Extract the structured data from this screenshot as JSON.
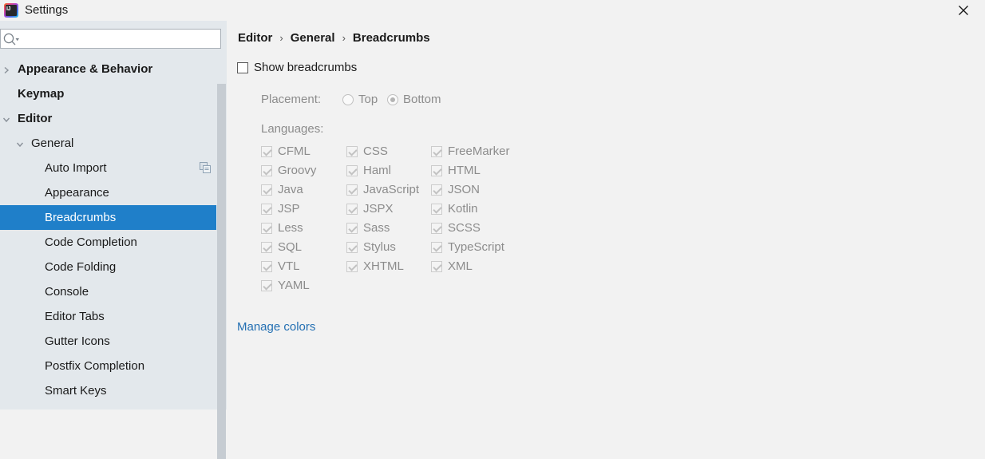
{
  "window": {
    "title": "Settings",
    "app_icon": "intellij-idea-logo",
    "close_icon": "close-icon"
  },
  "search": {
    "icon": "search-icon",
    "value": "",
    "placeholder": ""
  },
  "sidebar": {
    "items": [
      {
        "label": "Appearance & Behavior",
        "indent": 22,
        "bold": true,
        "arrow": "collapsed",
        "selected": false
      },
      {
        "label": "Keymap",
        "indent": 22,
        "bold": true,
        "arrow": "none",
        "selected": false
      },
      {
        "label": "Editor",
        "indent": 22,
        "bold": true,
        "arrow": "expanded",
        "selected": false
      },
      {
        "label": "General",
        "indent": 39,
        "bold": false,
        "arrow": "expanded",
        "selected": false
      },
      {
        "label": "Auto Import",
        "indent": 56,
        "bold": false,
        "arrow": "none",
        "selected": false,
        "action_icon": "copy-icon"
      },
      {
        "label": "Appearance",
        "indent": 56,
        "bold": false,
        "arrow": "none",
        "selected": false
      },
      {
        "label": "Breadcrumbs",
        "indent": 56,
        "bold": false,
        "arrow": "none",
        "selected": true
      },
      {
        "label": "Code Completion",
        "indent": 56,
        "bold": false,
        "arrow": "none",
        "selected": false
      },
      {
        "label": "Code Folding",
        "indent": 56,
        "bold": false,
        "arrow": "none",
        "selected": false
      },
      {
        "label": "Console",
        "indent": 56,
        "bold": false,
        "arrow": "none",
        "selected": false
      },
      {
        "label": "Editor Tabs",
        "indent": 56,
        "bold": false,
        "arrow": "none",
        "selected": false
      },
      {
        "label": "Gutter Icons",
        "indent": 56,
        "bold": false,
        "arrow": "none",
        "selected": false
      },
      {
        "label": "Postfix Completion",
        "indent": 56,
        "bold": false,
        "arrow": "none",
        "selected": false
      },
      {
        "label": "Smart Keys",
        "indent": 56,
        "bold": false,
        "arrow": "none",
        "selected": false
      }
    ]
  },
  "main": {
    "breadcrumb": {
      "items": [
        "Editor",
        "General",
        "Breadcrumbs"
      ],
      "separator": "›"
    },
    "show_breadcrumbs": {
      "label": "Show breadcrumbs",
      "checked": false
    },
    "placement": {
      "label": "Placement:",
      "options": [
        {
          "label": "Top",
          "selected": false
        },
        {
          "label": "Bottom",
          "selected": true
        }
      ]
    },
    "languages": {
      "label": "Languages:",
      "items": [
        {
          "label": "CFML",
          "checked": true,
          "col": 0,
          "row": 0
        },
        {
          "label": "CSS",
          "checked": true,
          "col": 1,
          "row": 0
        },
        {
          "label": "FreeMarker",
          "checked": true,
          "col": 2,
          "row": 0
        },
        {
          "label": "Groovy",
          "checked": true,
          "col": 0,
          "row": 1
        },
        {
          "label": "Haml",
          "checked": true,
          "col": 1,
          "row": 1
        },
        {
          "label": "HTML",
          "checked": true,
          "col": 2,
          "row": 1
        },
        {
          "label": "Java",
          "checked": true,
          "col": 0,
          "row": 2
        },
        {
          "label": "JavaScript",
          "checked": true,
          "col": 1,
          "row": 2
        },
        {
          "label": "JSON",
          "checked": true,
          "col": 2,
          "row": 2
        },
        {
          "label": "JSP",
          "checked": true,
          "col": 0,
          "row": 3
        },
        {
          "label": "JSPX",
          "checked": true,
          "col": 1,
          "row": 3
        },
        {
          "label": "Kotlin",
          "checked": true,
          "col": 2,
          "row": 3
        },
        {
          "label": "Less",
          "checked": true,
          "col": 0,
          "row": 4
        },
        {
          "label": "Sass",
          "checked": true,
          "col": 1,
          "row": 4
        },
        {
          "label": "SCSS",
          "checked": true,
          "col": 2,
          "row": 4
        },
        {
          "label": "SQL",
          "checked": true,
          "col": 0,
          "row": 5
        },
        {
          "label": "Stylus",
          "checked": true,
          "col": 1,
          "row": 5
        },
        {
          "label": "TypeScript",
          "checked": true,
          "col": 2,
          "row": 5
        },
        {
          "label": "VTL",
          "checked": true,
          "col": 0,
          "row": 6
        },
        {
          "label": "XHTML",
          "checked": true,
          "col": 1,
          "row": 6
        },
        {
          "label": "XML",
          "checked": true,
          "col": 2,
          "row": 6
        },
        {
          "label": "YAML",
          "checked": true,
          "col": 0,
          "row": 7
        }
      ]
    },
    "manage_colors_link": "Manage colors"
  },
  "colors": {
    "selection_blue": "#1f7fc9",
    "link_blue": "#2470b3",
    "sidebar_bg": "#e3e8ec",
    "panel_bg": "#f2f2f2",
    "disabled_text": "#8c8c8c"
  }
}
